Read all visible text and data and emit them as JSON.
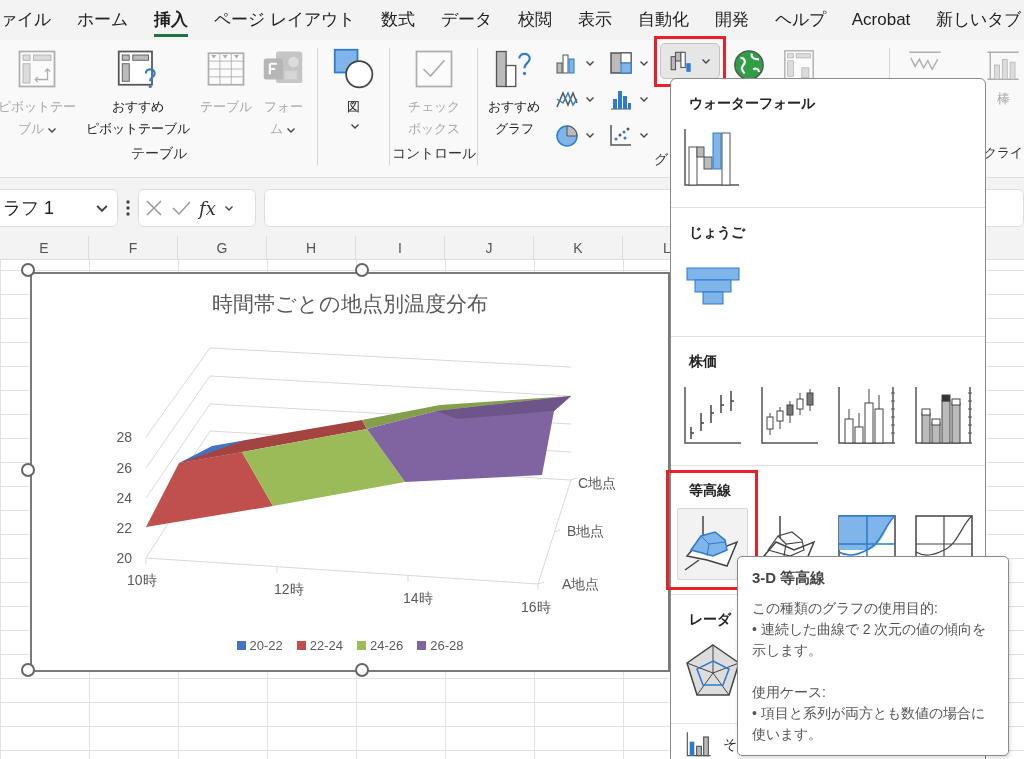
{
  "ribbon_tabs": [
    {
      "label": "ァイル",
      "selected": false
    },
    {
      "label": "ホーム",
      "selected": false
    },
    {
      "label": "挿入",
      "selected": true
    },
    {
      "label": "ページ レイアウト",
      "selected": false
    },
    {
      "label": "数式",
      "selected": false
    },
    {
      "label": "データ",
      "selected": false
    },
    {
      "label": "校閲",
      "selected": false
    },
    {
      "label": "表示",
      "selected": false
    },
    {
      "label": "自動化",
      "selected": false
    },
    {
      "label": "開発",
      "selected": false
    },
    {
      "label": "ヘルプ",
      "selected": false
    },
    {
      "label": "Acrobat",
      "selected": false
    },
    {
      "label": "新しいタブ",
      "selected": false
    }
  ],
  "ribbon_groups": [
    {
      "kind": "table",
      "label": "テーブル",
      "buttons": [
        {
          "label": "ピボットテーブル",
          "disabled": true,
          "expanded": false
        },
        {
          "label": "おすすめピボットテーブル",
          "disabled": false,
          "expanded": false
        },
        {
          "label": "テーブル",
          "disabled": true,
          "expanded": false
        },
        {
          "label": "フォーム",
          "disabled": true,
          "expanded": false
        }
      ]
    },
    {
      "kind": "illustration",
      "buttons": [
        {
          "label": "図",
          "disabled": false,
          "expanded": false
        }
      ]
    },
    {
      "kind": "control",
      "label": "コントロール",
      "buttons": [
        {
          "label": "チェックボックス",
          "disabled": true,
          "expanded": false
        }
      ]
    },
    {
      "kind": "chart",
      "label": "グ",
      "buttons": [
        {
          "label": "おすすめグラフ",
          "disabled": false,
          "expanded": false
        },
        {
          "disabled": false,
          "expanded": false
        },
        {
          "disabled": false,
          "expanded": false
        },
        {
          "disabled": false,
          "expanded": false
        },
        {
          "disabled": false,
          "expanded": false
        },
        {
          "disabled": false,
          "expanded": false
        },
        {
          "disabled": false,
          "expanded": false
        },
        {
          "disabled": false,
          "expanded": true,
          "highlight_frame": true
        },
        {
          "disabled": false,
          "expanded": false
        },
        {
          "disabled": true,
          "expanded": false
        }
      ]
    },
    {
      "kind": "sparkline",
      "label": "クライ",
      "buttons": [
        {
          "disabled": true,
          "expanded": false
        },
        {
          "label": "棒",
          "disabled": true,
          "expanded": false
        }
      ]
    }
  ],
  "formula_bar": {
    "name_box": "ラフ 1",
    "function_label": "fx"
  },
  "column_headers": [
    "E",
    "F",
    "G",
    "H",
    "I",
    "J",
    "K",
    "L"
  ],
  "chart": {
    "title": "時間帯ごとの地点別温度分布",
    "selected": true,
    "y_ticks": [
      "28",
      "26",
      "24",
      "22",
      "20"
    ],
    "x_labels": [
      "10時",
      "12時",
      "14時",
      "16時"
    ],
    "depth_labels": [
      "C地点",
      "B地点",
      "A地点"
    ],
    "legend": [
      {
        "label": "20-22",
        "color": "#4472c4"
      },
      {
        "label": "22-24",
        "color": "#c0504d"
      },
      {
        "label": "24-26",
        "color": "#9bbb59"
      },
      {
        "label": "26-28",
        "color": "#8064a2"
      }
    ]
  },
  "chart_menu": {
    "sections": [
      {
        "heading": "ウォーターフォール",
        "highlight_frame": false,
        "items": [
          {
            "kind": "waterfall",
            "selected": false
          }
        ]
      },
      {
        "heading": "じょうご",
        "highlight_frame": false,
        "items": [
          {
            "kind": "funnel",
            "selected": false
          }
        ]
      },
      {
        "heading": "株価",
        "highlight_frame": false,
        "items": [
          {
            "kind": "stock-hlc",
            "selected": false
          },
          {
            "kind": "stock-ohlc",
            "selected": false
          },
          {
            "kind": "stock-vhlc",
            "selected": false
          },
          {
            "kind": "stock-vohlc",
            "selected": false
          }
        ]
      },
      {
        "heading": "等高線",
        "highlight_frame": true,
        "items": [
          {
            "kind": "surface-3d",
            "selected": true
          },
          {
            "kind": "wireframe-3d",
            "selected": false
          },
          {
            "kind": "contour",
            "selected": false
          },
          {
            "kind": "wire-contour",
            "selected": false
          }
        ]
      },
      {
        "heading": "レーダ",
        "highlight_frame": false,
        "items": [
          {
            "kind": "radar",
            "selected": false
          }
        ]
      }
    ],
    "more": {
      "label": "そ"
    }
  },
  "tooltip": {
    "title": "3-D 等高線",
    "sections": [
      {
        "heading": "この種類のグラフの使用目的:",
        "bullet": "• 連続した曲線で 2 次元の値の傾向を示します。"
      },
      {
        "heading": "使用ケース:",
        "bullet": "• 項目と系列が両方とも数値の場合に使います。"
      }
    ]
  }
}
